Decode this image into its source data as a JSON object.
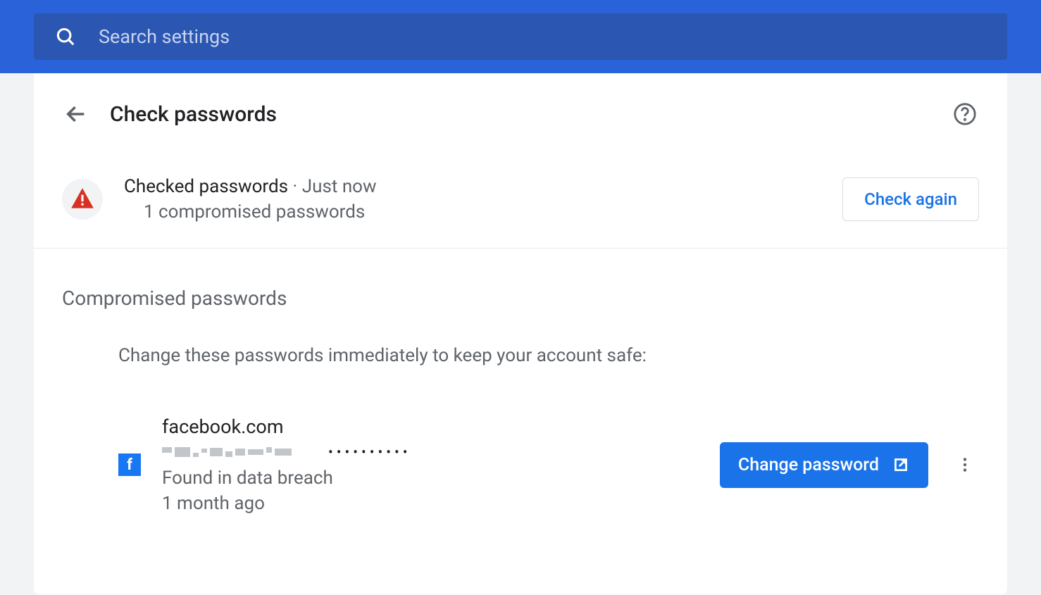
{
  "search": {
    "placeholder": "Search settings"
  },
  "header": {
    "title": "Check passwords"
  },
  "status": {
    "checked_label": "Checked passwords",
    "separator": " · ",
    "time": "Just now",
    "summary": "1 compromised passwords",
    "check_again_label": "Check again"
  },
  "compromised": {
    "section_title": "Compromised passwords",
    "instruction": "Change these passwords immediately to keep your account safe:",
    "items": [
      {
        "site": "facebook.com",
        "password_dots": "••••••••••",
        "breach_label": "Found in data breach",
        "breach_time": "1 month ago",
        "change_label": "Change password"
      }
    ]
  }
}
